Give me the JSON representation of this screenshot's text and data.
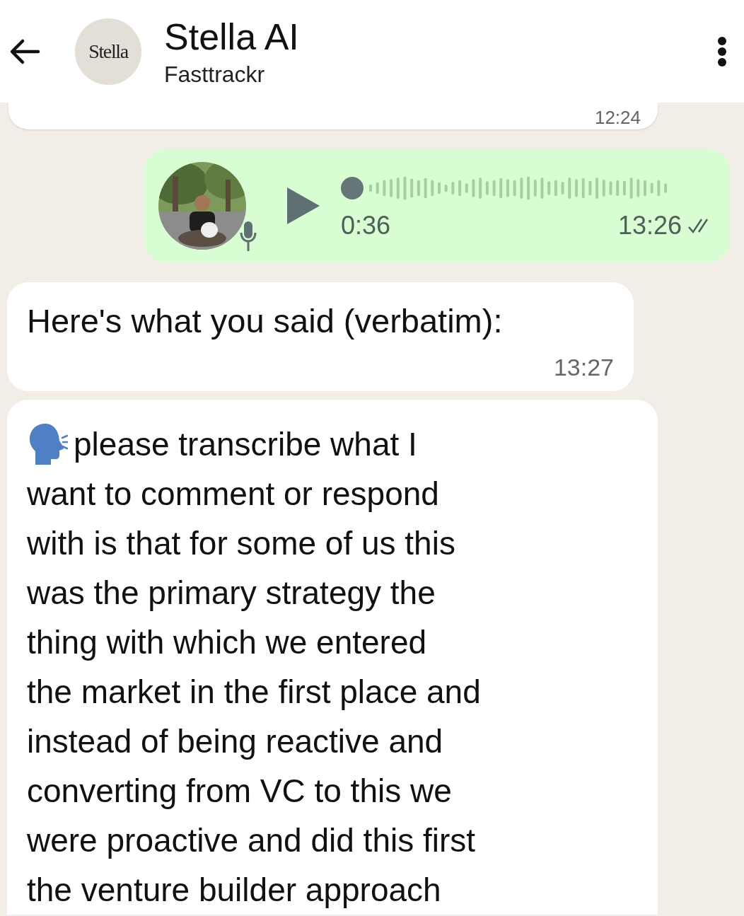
{
  "header": {
    "logo_text": "Stella",
    "title": "Stella AI",
    "subtitle": "Fasttrackr"
  },
  "messages": [
    {
      "kind": "cut",
      "time": "12:24"
    },
    {
      "kind": "voice",
      "outgoing": true,
      "duration": "0:36",
      "time": "13:26",
      "read": false
    },
    {
      "kind": "text",
      "outgoing": false,
      "text": "Here's what you said (verbatim):",
      "time": "13:27"
    },
    {
      "kind": "transcript",
      "outgoing": false,
      "lines": [
        "please transcribe what I",
        "want to comment or respond",
        "with is that for some of us this",
        "was the primary strategy the",
        "thing with which we entered",
        "the market in the first place and",
        "instead of being reactive and",
        "converting from VC to this we",
        "were proactive and did this first",
        "the venture builder approach"
      ]
    }
  ]
}
